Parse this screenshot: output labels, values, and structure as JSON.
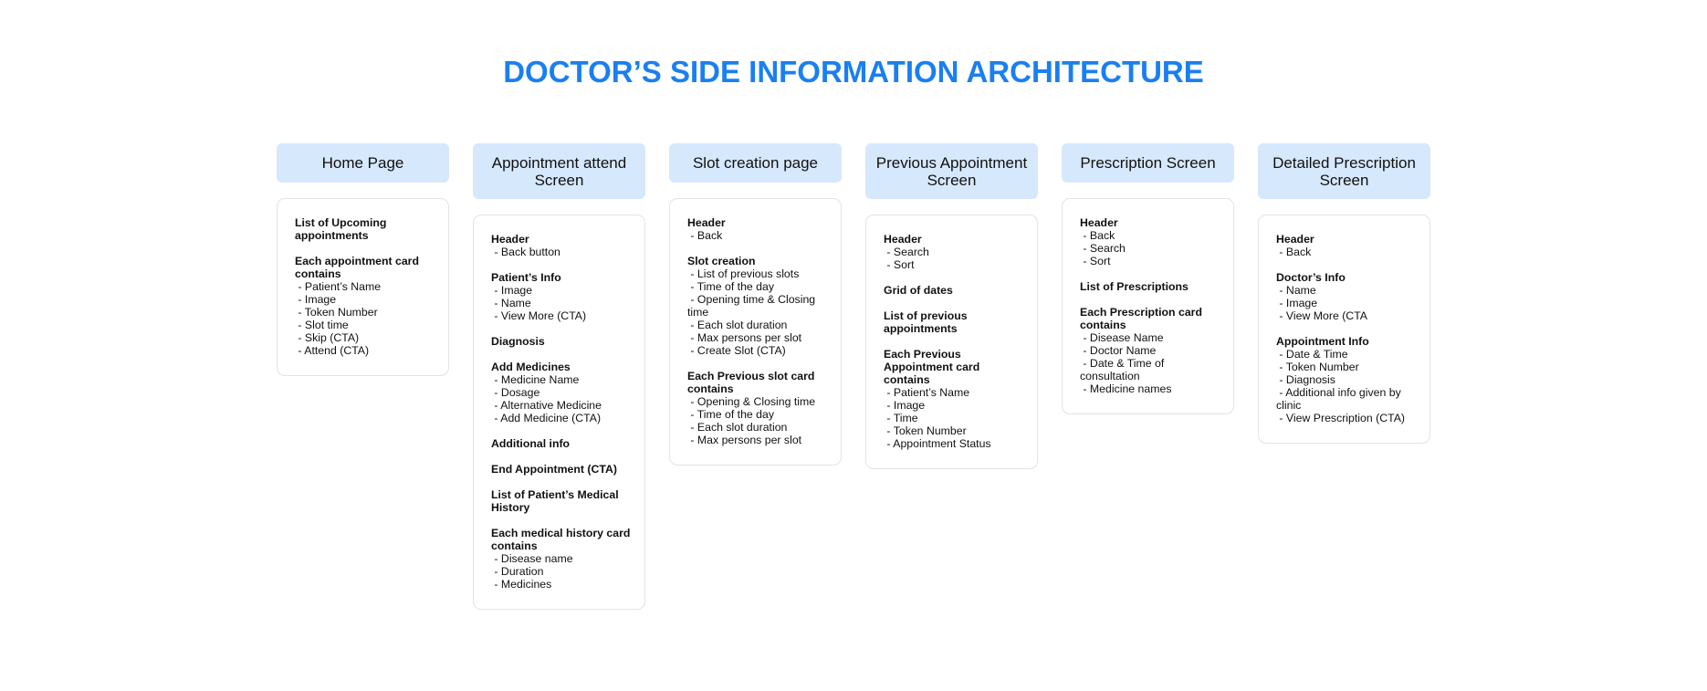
{
  "title": "DOCTOR’S SIDE INFORMATION ARCHITECTURE",
  "colors": {
    "accent": "#1a7ff0",
    "header_bg": "#d6e8fc",
    "box_border": "#e3e3e3"
  },
  "columns": [
    {
      "header": "Home Page",
      "sections": [
        {
          "title": "List of Upcoming appointments",
          "items": []
        },
        {
          "title": "Each appointment card contains",
          "items": [
            " - Patient’s Name",
            " - Image",
            " - Token Number",
            " - Slot time",
            " - Skip (CTA)",
            " - Attend (CTA)"
          ]
        }
      ]
    },
    {
      "header": "Appointment attend Screen",
      "sections": [
        {
          "title": "Header",
          "items": [
            " - Back button"
          ]
        },
        {
          "title": "Patient’s Info",
          "items": [
            " - Image",
            " - Name",
            " - View More (CTA)"
          ]
        },
        {
          "title": "Diagnosis",
          "items": []
        },
        {
          "title": "Add Medicines",
          "items": [
            " - Medicine Name",
            " - Dosage",
            " - Alternative Medicine",
            " - Add Medicine (CTA)"
          ]
        },
        {
          "title": "Additional info",
          "items": []
        },
        {
          "title": "End Appointment (CTA)",
          "items": []
        },
        {
          "title": "List of Patient’s Medical History",
          "items": []
        },
        {
          "title": "Each medical history card contains",
          "items": [
            " - Disease name",
            " - Duration",
            " - Medicines"
          ]
        }
      ]
    },
    {
      "header": "Slot creation page",
      "sections": [
        {
          "title": "Header",
          "items": [
            " - Back"
          ]
        },
        {
          "title": "Slot creation",
          "items": [
            " - List of previous slots",
            " - Time of the day",
            " - Opening time & Closing time",
            " - Each slot duration",
            " - Max persons per slot",
            " - Create Slot (CTA)"
          ]
        },
        {
          "title": "Each Previous slot card contains",
          "items": [
            " - Opening & Closing time",
            " - Time of the day",
            " - Each slot duration",
            " - Max persons per slot"
          ]
        }
      ]
    },
    {
      "header": "Previous Appointment Screen",
      "sections": [
        {
          "title": "Header",
          "items": [
            " - Search",
            " - Sort"
          ]
        },
        {
          "title": "Grid of dates",
          "items": []
        },
        {
          "title": "List of previous appointments",
          "items": []
        },
        {
          "title": "Each Previous Appointment card contains",
          "items": [
            " - Patient’s Name",
            " - Image",
            " - Time",
            " - Token Number",
            " - Appointment Status"
          ]
        }
      ]
    },
    {
      "header": "Prescription Screen",
      "sections": [
        {
          "title": "Header",
          "items": [
            " - Back",
            " - Search",
            " - Sort"
          ]
        },
        {
          "title": "List of Prescriptions",
          "items": []
        },
        {
          "title": "Each Prescription card contains",
          "items": [
            " - Disease Name",
            " - Doctor Name",
            " - Date & Time of consultation",
            " - Medicine names"
          ]
        }
      ]
    },
    {
      "header": "Detailed Prescription Screen",
      "sections": [
        {
          "title": "Header",
          "items": [
            " - Back"
          ]
        },
        {
          "title": "Doctor’s Info",
          "items": [
            " - Name",
            " - Image",
            " - View More (CTA"
          ]
        },
        {
          "title": "Appointment Info",
          "items": [
            " - Date & Time",
            " - Token Number",
            " - Diagnosis",
            " - Additional info given by clinic",
            " - View Prescription (CTA)"
          ]
        }
      ]
    }
  ]
}
